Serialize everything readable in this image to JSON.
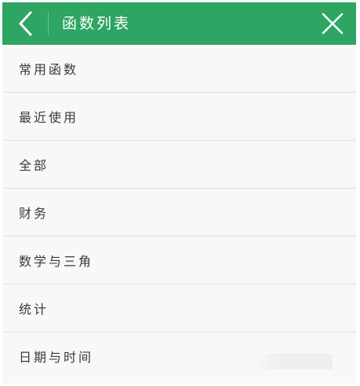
{
  "header": {
    "title": "函数列表",
    "back_icon": "chevron-left-icon",
    "close_icon": "close-icon",
    "background_color": "#2ea562",
    "text_color": "#ffffff"
  },
  "list": {
    "items": [
      {
        "label": "常用函数"
      },
      {
        "label": "最近使用"
      },
      {
        "label": "全部"
      },
      {
        "label": "财务"
      },
      {
        "label": "数学与三角"
      },
      {
        "label": "统计"
      },
      {
        "label": "日期与时间"
      }
    ]
  }
}
